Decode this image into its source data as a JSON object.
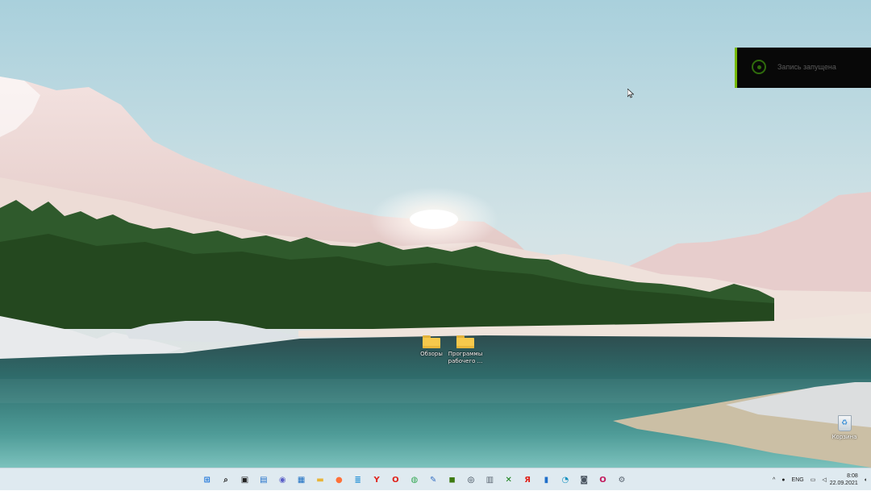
{
  "desktop": {
    "icons": [
      {
        "label": "Обзоры"
      },
      {
        "label": "Программы рабочего ..."
      }
    ],
    "recycle_bin_label": "Корзина"
  },
  "notification": {
    "text": "Запись запущена",
    "icon": "record-icon",
    "accent": "#76b900"
  },
  "taskbar": {
    "apps": [
      {
        "name": "start-icon",
        "glyph": "⊞",
        "color": "#1a73d9"
      },
      {
        "name": "search-icon",
        "glyph": "⌕",
        "color": "#222222"
      },
      {
        "name": "task-view-icon",
        "glyph": "▣",
        "color": "#222222"
      },
      {
        "name": "widgets-icon",
        "glyph": "▤",
        "color": "#1f6fc9"
      },
      {
        "name": "chat-icon",
        "glyph": "◉",
        "color": "#5b5fc7"
      },
      {
        "name": "store-icon",
        "glyph": "▦",
        "color": "#1b6ec2"
      },
      {
        "name": "file-explorer-icon",
        "glyph": "▬",
        "color": "#e8b437"
      },
      {
        "name": "firefox-icon",
        "glyph": "●",
        "color": "#ff7139"
      },
      {
        "name": "notepad-icon",
        "glyph": "≣",
        "color": "#1f8fd6"
      },
      {
        "name": "yandex-icon",
        "glyph": "Y",
        "color": "#e0231b"
      },
      {
        "name": "opera-icon",
        "glyph": "O",
        "color": "#e0231b"
      },
      {
        "name": "chrome-icon",
        "glyph": "◍",
        "color": "#34a853"
      },
      {
        "name": "paint-icon",
        "glyph": "✎",
        "color": "#3a72c4"
      },
      {
        "name": "nvidia-icon",
        "glyph": "◼",
        "color": "#3d7a10"
      },
      {
        "name": "steam-icon",
        "glyph": "◎",
        "color": "#1b2838"
      },
      {
        "name": "calculator-icon",
        "glyph": "▥",
        "color": "#5a6470"
      },
      {
        "name": "xbox-icon",
        "glyph": "✕",
        "color": "#107c10"
      },
      {
        "name": "yandex-browser-icon",
        "glyph": "Я",
        "color": "#e0231b"
      },
      {
        "name": "phone-icon",
        "glyph": "▮",
        "color": "#1f6fc9"
      },
      {
        "name": "edge-icon",
        "glyph": "◔",
        "color": "#0f8fbf"
      },
      {
        "name": "camera-icon",
        "glyph": "◙",
        "color": "#4a5560"
      },
      {
        "name": "opera-gx-icon",
        "glyph": "O",
        "color": "#c2185b"
      },
      {
        "name": "settings-icon",
        "glyph": "⚙",
        "color": "#5a6470"
      }
    ],
    "tray": {
      "chevron": "^",
      "mic_icon": "microphone-icon",
      "language": "ENG",
      "network_icon": "network-icon",
      "volume_icon": "volume-icon",
      "time": "8:08",
      "date": "22.09.2021",
      "notifications_icon": "notifications-icon"
    }
  }
}
